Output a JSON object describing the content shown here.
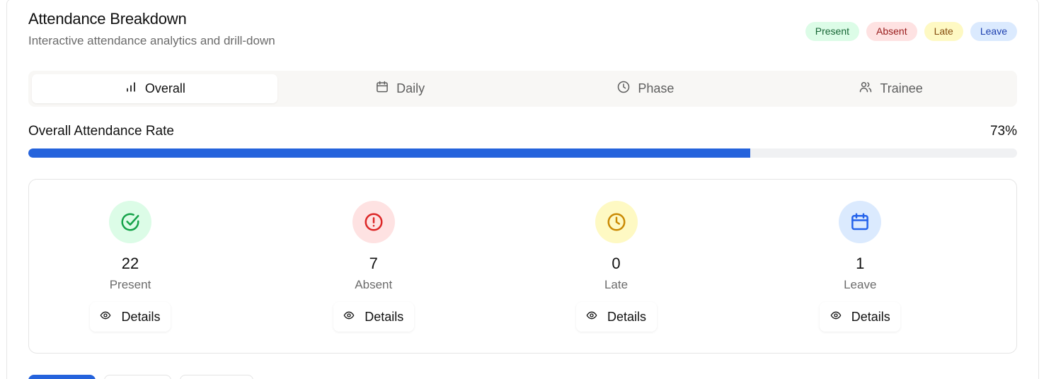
{
  "header": {
    "title": "Attendance Breakdown",
    "subtitle": "Interactive attendance analytics and drill-down"
  },
  "legend": [
    {
      "label": "Present",
      "bg": "#dcfce7",
      "fg": "#166534"
    },
    {
      "label": "Absent",
      "bg": "#fee2e2",
      "fg": "#991b1b"
    },
    {
      "label": "Late",
      "bg": "#fef9c3",
      "fg": "#854d0e"
    },
    {
      "label": "Leave",
      "bg": "#dbeafe",
      "fg": "#1e40af"
    }
  ],
  "tabs": [
    {
      "label": "Overall",
      "icon": "bar-chart-icon",
      "active": true
    },
    {
      "label": "Daily",
      "icon": "calendar-icon",
      "active": false
    },
    {
      "label": "Phase",
      "icon": "clock-icon",
      "active": false
    },
    {
      "label": "Trainee",
      "icon": "users-icon",
      "active": false
    }
  ],
  "rate": {
    "label": "Overall Attendance Rate",
    "value_text": "73%",
    "fraction": 0.73,
    "color": "#2563dc"
  },
  "stats": [
    {
      "count": "22",
      "label": "Present",
      "icon": "check-circle-icon",
      "icon_bg": "#dcfce7",
      "icon_color": "#16a34a",
      "button": "Details"
    },
    {
      "count": "7",
      "label": "Absent",
      "icon": "alert-circle-icon",
      "icon_bg": "#fee2e2",
      "icon_color": "#dc2626",
      "button": "Details"
    },
    {
      "count": "0",
      "label": "Late",
      "icon": "clock-icon",
      "icon_bg": "#fef9c3",
      "icon_color": "#ca8a04",
      "button": "Details"
    },
    {
      "count": "1",
      "label": "Leave",
      "icon": "calendar-icon",
      "icon_bg": "#dbeafe",
      "icon_color": "#2563eb",
      "button": "Details"
    }
  ]
}
